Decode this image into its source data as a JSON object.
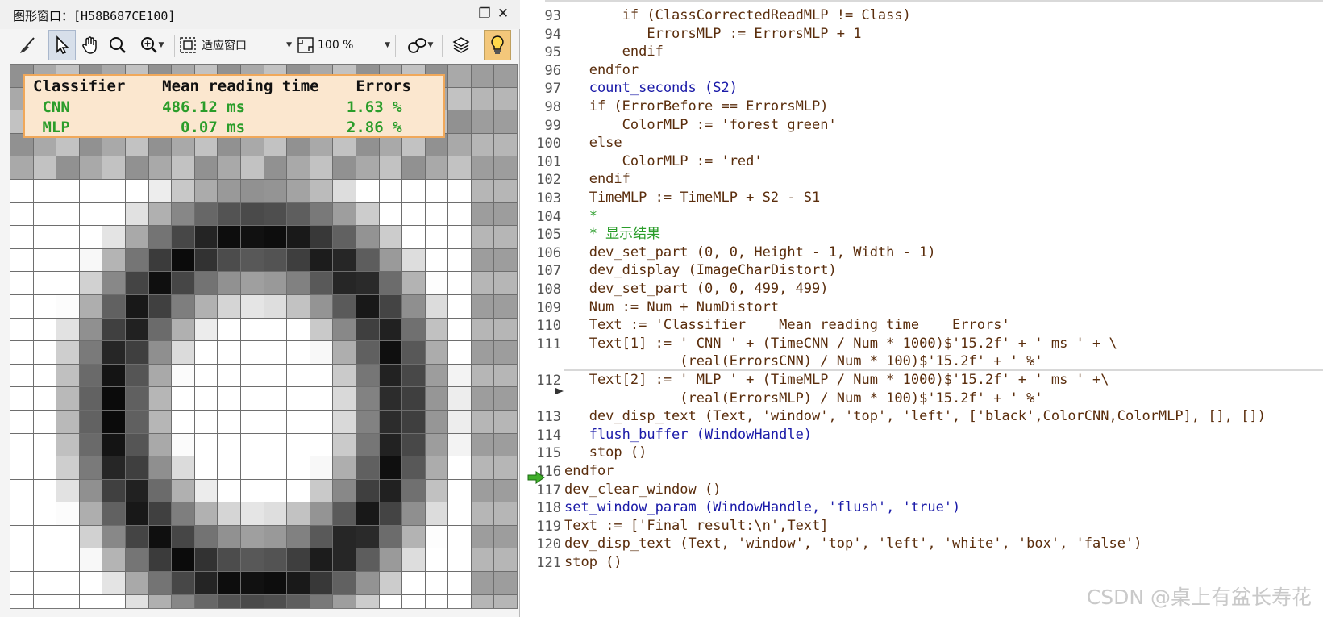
{
  "graphics_window": {
    "title": "图形窗口：[H58B687CE100]",
    "toolbar": {
      "fit_label": "适应窗口",
      "zoom_label": "100 %"
    },
    "result_box": {
      "header": "Classifier    Mean reading time    Errors",
      "cnn_row": " CNN          486.12 ms           1.63 %",
      "mlp_row": " MLP            0.07 ms           2.86 %"
    }
  },
  "editor": {
    "lines": [
      {
        "n": "93",
        "text": "       if (ClassCorrectedReadMLP != Class)",
        "kind": "ctl"
      },
      {
        "n": "94",
        "text": "          ErrorsMLP := ErrorsMLP + 1",
        "kind": "ctl"
      },
      {
        "n": "95",
        "text": "       endif",
        "kind": "ctl"
      },
      {
        "n": "96",
        "text": "   endfor",
        "kind": "ctl"
      },
      {
        "n": "97",
        "text": "   count_seconds (S2)",
        "kind": "op"
      },
      {
        "n": "98",
        "text": "   if (ErrorBefore == ErrorsMLP)",
        "kind": "ctl"
      },
      {
        "n": "99",
        "text": "       ColorMLP := 'forest green'",
        "kind": "ctl"
      },
      {
        "n": "100",
        "text": "   else",
        "kind": "ctl"
      },
      {
        "n": "101",
        "text": "       ColorMLP := 'red'",
        "kind": "ctl"
      },
      {
        "n": "102",
        "text": "   endif",
        "kind": "ctl"
      },
      {
        "n": "103",
        "text": "   TimeMLP := TimeMLP + S2 - S1",
        "kind": "ctl"
      },
      {
        "n": "104",
        "text": "   *",
        "kind": "cmt"
      },
      {
        "n": "105",
        "text": "   * 显示结果",
        "kind": "cmt"
      },
      {
        "n": "106",
        "text": "   dev_set_part (0, 0, Height - 1, Width - 1)",
        "kind": "ctl"
      },
      {
        "n": "107",
        "text": "   dev_display (ImageCharDistort)",
        "kind": "ctl"
      },
      {
        "n": "108",
        "text": "   dev_set_part (0, 0, 499, 499)",
        "kind": "ctl"
      },
      {
        "n": "109",
        "text": "   Num := Num + NumDistort",
        "kind": "ctl"
      },
      {
        "n": "110",
        "text": "   Text := 'Classifier    Mean reading time    Errors'",
        "kind": "ctl"
      },
      {
        "n": "111",
        "text": "   Text[1] := ' CNN ' + (TimeCNN / Num * 1000)$'15.2f' + ' ms ' + \\",
        "kind": "ctl"
      },
      {
        "n": "",
        "text": "              (real(ErrorsCNN) / Num * 100)$'15.2f' + ' %'",
        "kind": "ctl"
      },
      {
        "n": "112",
        "text": "   Text[2] := ' MLP ' + (TimeMLP / Num * 1000)$'15.2f' + ' ms ' +\\",
        "kind": "ctl"
      },
      {
        "n": "",
        "text": "              (real(ErrorsMLP) / Num * 100)$'15.2f' + ' %'",
        "kind": "ctl"
      },
      {
        "n": "113",
        "text": "   dev_disp_text (Text, 'window', 'top', 'left', ['black',ColorCNN,ColorMLP], [], [])",
        "kind": "ctl"
      },
      {
        "n": "114",
        "text": "   flush_buffer (WindowHandle)",
        "kind": "op"
      },
      {
        "n": "115",
        "text": "   stop ()",
        "kind": "ctl"
      },
      {
        "n": "116",
        "text": "endfor",
        "kind": "ctl"
      },
      {
        "n": "117",
        "text": "dev_clear_window ()",
        "kind": "ctl"
      },
      {
        "n": "118",
        "text": "set_window_param (WindowHandle, 'flush', 'true')",
        "kind": "op"
      },
      {
        "n": "119",
        "text": "Text := ['Final result:\\n',Text]",
        "kind": "ctl"
      },
      {
        "n": "120",
        "text": "dev_disp_text (Text, 'window', 'top', 'left', 'white', 'box', 'false')",
        "kind": "ctl"
      },
      {
        "n": "121",
        "text": "stop ()",
        "kind": "ctl"
      }
    ]
  },
  "watermark": "CSDN @桌上有盆长寿花",
  "colors": {
    "result_green": "#2a9d2a",
    "result_box_border": "#f0a85a",
    "result_box_bg": "#fbe7cf",
    "operator_blue": "#1a1aa8",
    "code_brown": "#5a2d0c"
  }
}
